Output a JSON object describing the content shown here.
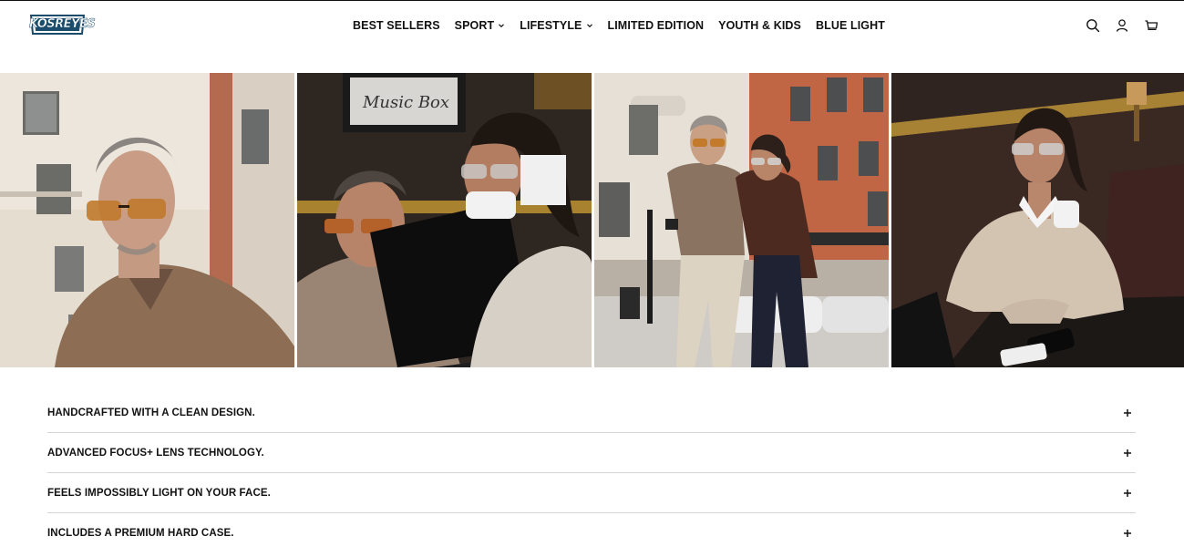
{
  "brand": {
    "logo_text": "KOSREYES",
    "logo_color": "#1b4c6b"
  },
  "nav": {
    "items": [
      {
        "label": "BEST SELLERS",
        "dropdown": false
      },
      {
        "label": "SPORT",
        "dropdown": true
      },
      {
        "label": "LIFESTYLE",
        "dropdown": true
      },
      {
        "label": "LIMITED EDITION",
        "dropdown": false
      },
      {
        "label": "YOUTH & KIDS",
        "dropdown": false
      },
      {
        "label": "BLUE LIGHT",
        "dropdown": false
      }
    ]
  },
  "header_icons": [
    "search-icon",
    "account-icon",
    "cart-icon"
  ],
  "gallery": {
    "photos": [
      {
        "name": "photo-man-amber-sunglasses"
      },
      {
        "name": "photo-couple-laptop-cafe"
      },
      {
        "name": "photo-couple-walking-street"
      },
      {
        "name": "photo-woman-sweater-table"
      }
    ]
  },
  "features": {
    "items": [
      {
        "label": "HANDCRAFTED WITH A CLEAN DESIGN."
      },
      {
        "label": "ADVANCED FOCUS+ LENS TECHNOLOGY."
      },
      {
        "label": "FEELS IMPOSSIBLY LIGHT ON YOUR FACE."
      },
      {
        "label": "INCLUDES A PREMIUM HARD CASE."
      }
    ]
  }
}
